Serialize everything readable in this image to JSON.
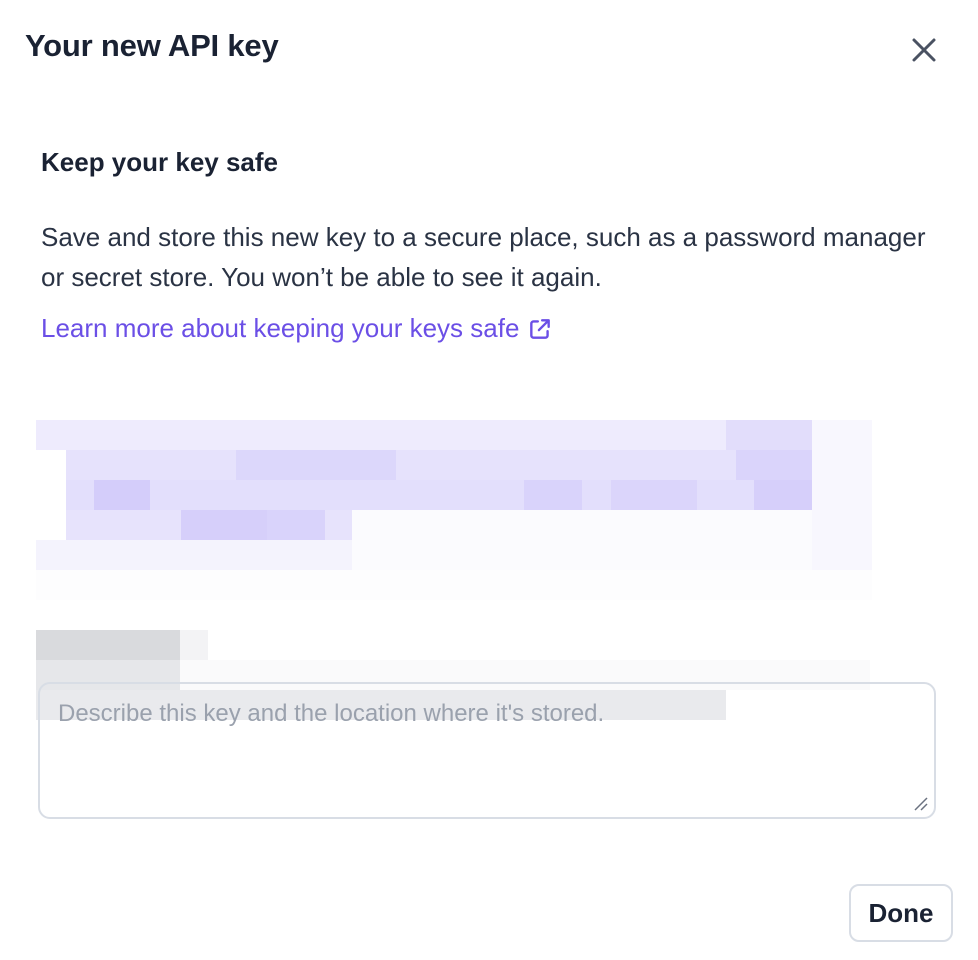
{
  "dialog": {
    "title": "Your new API key",
    "close_icon": "close-icon"
  },
  "content": {
    "heading": "Keep your key safe",
    "description": "Save and store this new key to a secure place, such as a password manager or secret store. You won’t be able to see it again.",
    "learn_link": "Learn more about keeping your keys safe",
    "learn_link_icon": "external-link-icon",
    "link_color": "#6b4fe6"
  },
  "description_field": {
    "placeholder": "Describe this key and the location where it's stored.",
    "value": ""
  },
  "footer": {
    "done_label": "Done"
  }
}
